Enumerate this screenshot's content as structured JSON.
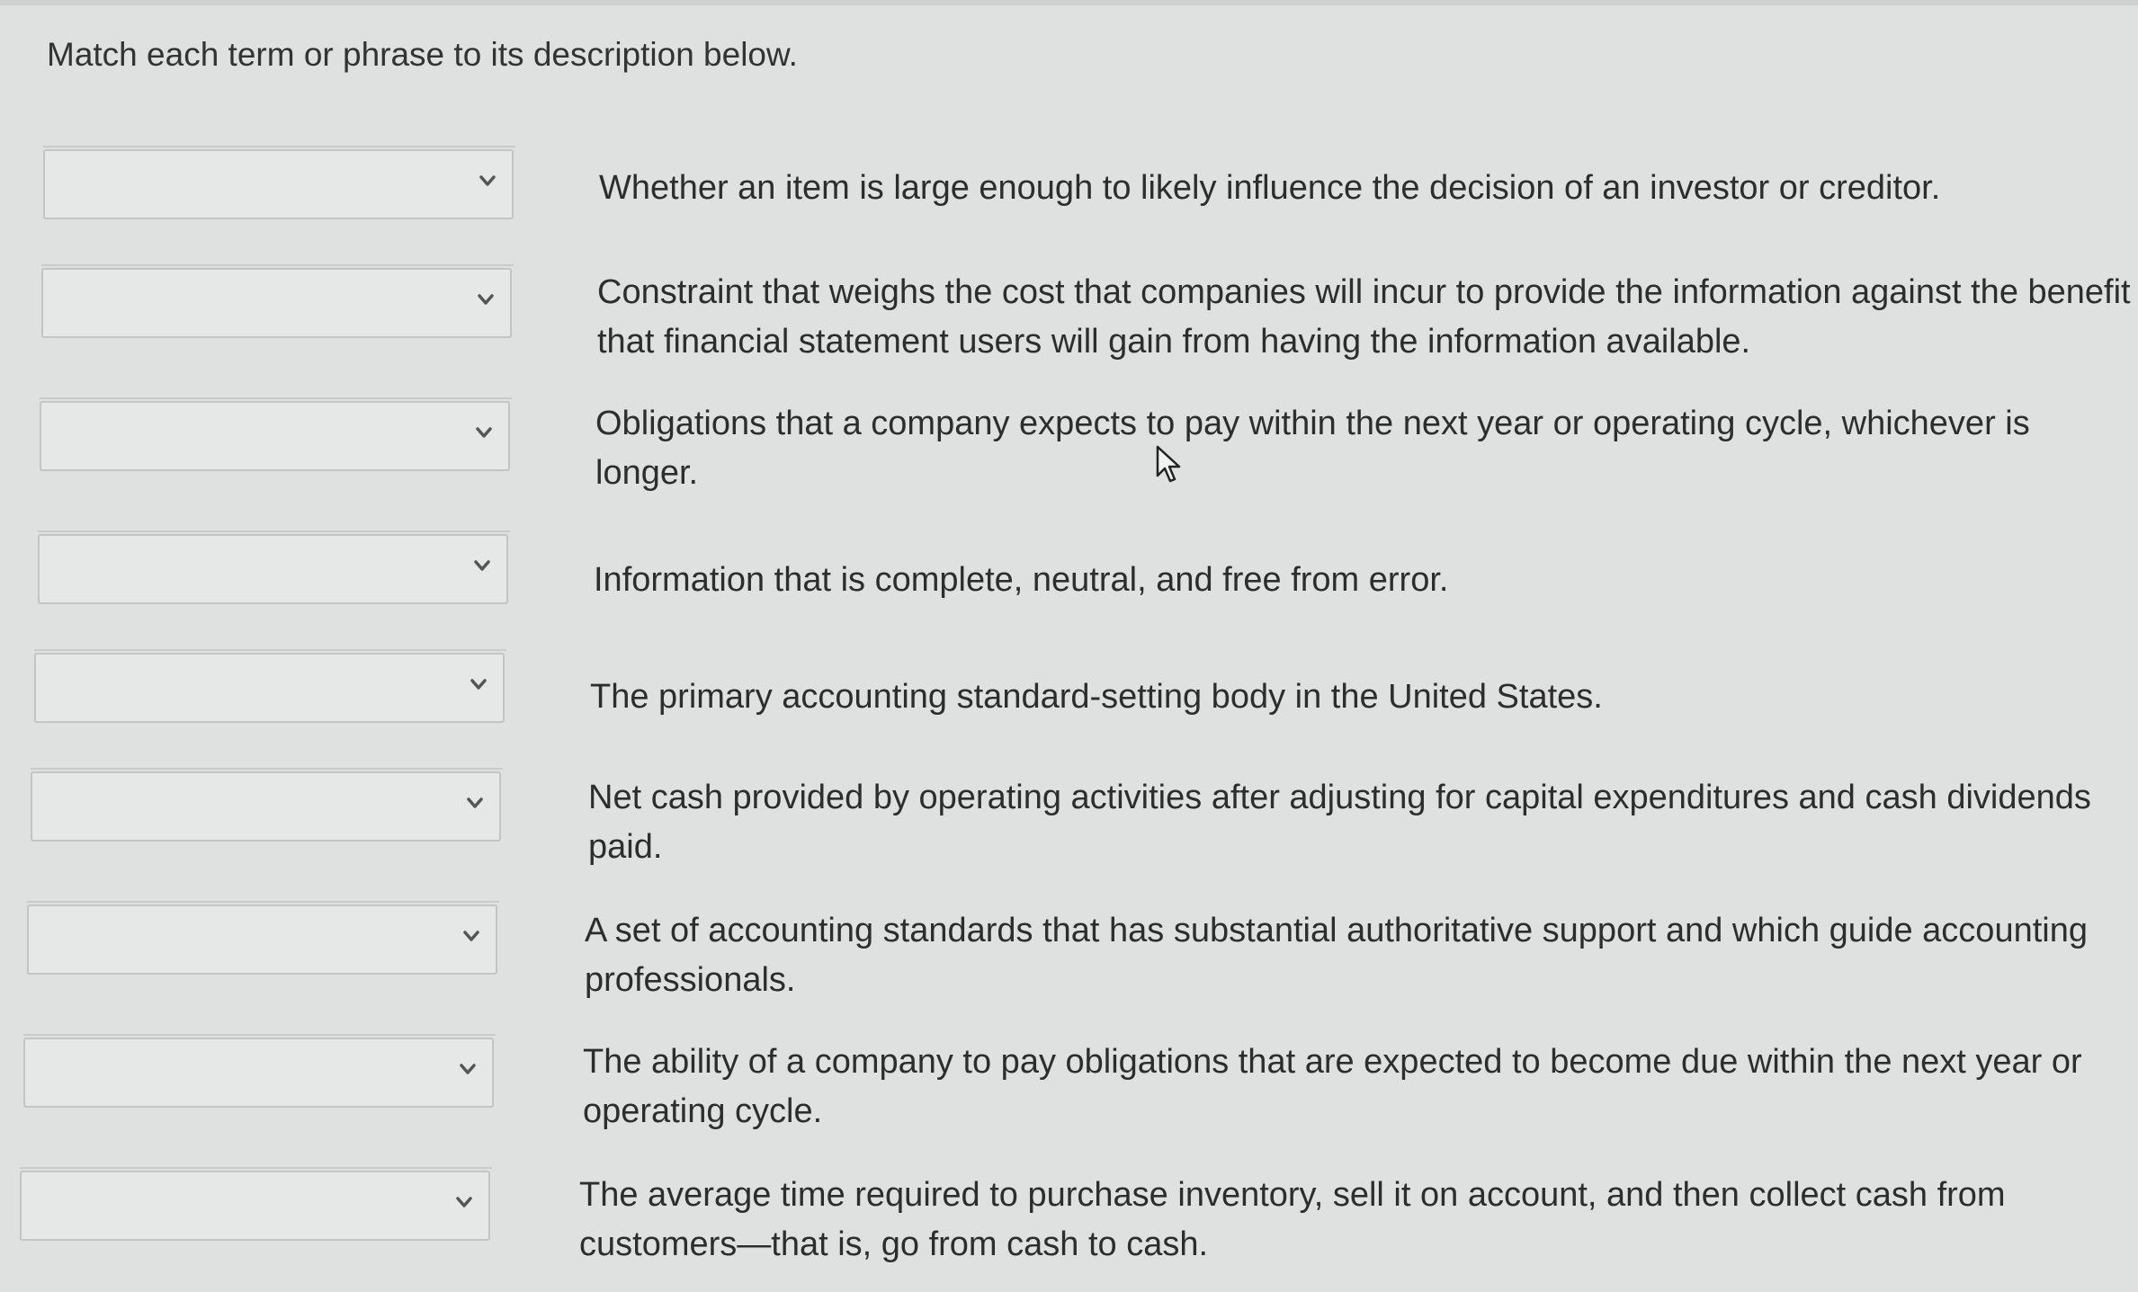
{
  "instruction": "Match each term or phrase to its description below.",
  "rows": [
    {
      "selected": "",
      "description": "Whether an item is large enough to likely influence the decision of an investor or creditor."
    },
    {
      "selected": "",
      "description": "Constraint that weighs the cost that companies will incur to provide the information against the benefit that financial statement users will gain from having the information available."
    },
    {
      "selected": "",
      "description": "Obligations that a company expects to pay within the next year or operating cycle, whichever is longer."
    },
    {
      "selected": "",
      "description": "Information that is complete, neutral, and free from error."
    },
    {
      "selected": "",
      "description": "The primary accounting standard-setting body in the United States."
    },
    {
      "selected": "",
      "description": "Net cash provided by operating activities after adjusting for capital expenditures and cash dividends paid."
    },
    {
      "selected": "",
      "description": "A set of accounting standards that has substantial authoritative support and which guide accounting professionals."
    },
    {
      "selected": "",
      "description": "The ability of a company to pay obligations that are expected to become due within the next year or operating cycle."
    },
    {
      "selected": "",
      "description": "The average time required to purchase inventory, sell it on account, and then collect cash from customers—that is, go from cash to cash."
    }
  ],
  "icons": {
    "dropdown": "chevron-down-icon",
    "cursor": "mouse-cursor-icon"
  }
}
